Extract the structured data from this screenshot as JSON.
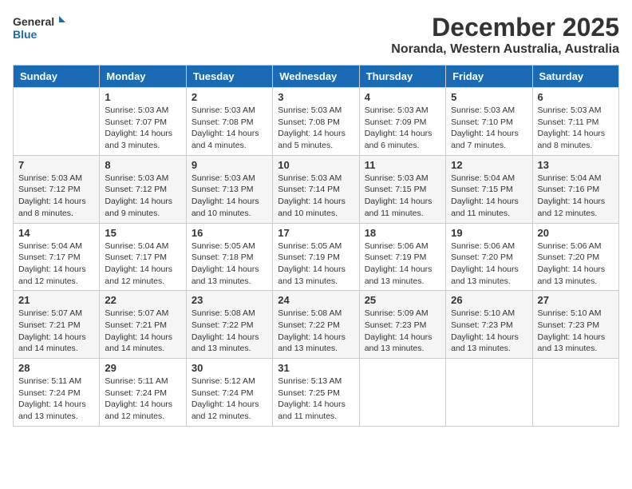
{
  "header": {
    "logo_line1": "General",
    "logo_line2": "Blue",
    "month": "December 2025",
    "location": "Noranda, Western Australia, Australia"
  },
  "days_of_week": [
    "Sunday",
    "Monday",
    "Tuesday",
    "Wednesday",
    "Thursday",
    "Friday",
    "Saturday"
  ],
  "weeks": [
    [
      {
        "day": "",
        "info": ""
      },
      {
        "day": "1",
        "info": "Sunrise: 5:03 AM\nSunset: 7:07 PM\nDaylight: 14 hours\nand 3 minutes."
      },
      {
        "day": "2",
        "info": "Sunrise: 5:03 AM\nSunset: 7:08 PM\nDaylight: 14 hours\nand 4 minutes."
      },
      {
        "day": "3",
        "info": "Sunrise: 5:03 AM\nSunset: 7:08 PM\nDaylight: 14 hours\nand 5 minutes."
      },
      {
        "day": "4",
        "info": "Sunrise: 5:03 AM\nSunset: 7:09 PM\nDaylight: 14 hours\nand 6 minutes."
      },
      {
        "day": "5",
        "info": "Sunrise: 5:03 AM\nSunset: 7:10 PM\nDaylight: 14 hours\nand 7 minutes."
      },
      {
        "day": "6",
        "info": "Sunrise: 5:03 AM\nSunset: 7:11 PM\nDaylight: 14 hours\nand 8 minutes."
      }
    ],
    [
      {
        "day": "7",
        "info": "Sunrise: 5:03 AM\nSunset: 7:12 PM\nDaylight: 14 hours\nand 8 minutes."
      },
      {
        "day": "8",
        "info": "Sunrise: 5:03 AM\nSunset: 7:12 PM\nDaylight: 14 hours\nand 9 minutes."
      },
      {
        "day": "9",
        "info": "Sunrise: 5:03 AM\nSunset: 7:13 PM\nDaylight: 14 hours\nand 10 minutes."
      },
      {
        "day": "10",
        "info": "Sunrise: 5:03 AM\nSunset: 7:14 PM\nDaylight: 14 hours\nand 10 minutes."
      },
      {
        "day": "11",
        "info": "Sunrise: 5:03 AM\nSunset: 7:15 PM\nDaylight: 14 hours\nand 11 minutes."
      },
      {
        "day": "12",
        "info": "Sunrise: 5:04 AM\nSunset: 7:15 PM\nDaylight: 14 hours\nand 11 minutes."
      },
      {
        "day": "13",
        "info": "Sunrise: 5:04 AM\nSunset: 7:16 PM\nDaylight: 14 hours\nand 12 minutes."
      }
    ],
    [
      {
        "day": "14",
        "info": "Sunrise: 5:04 AM\nSunset: 7:17 PM\nDaylight: 14 hours\nand 12 minutes."
      },
      {
        "day": "15",
        "info": "Sunrise: 5:04 AM\nSunset: 7:17 PM\nDaylight: 14 hours\nand 12 minutes."
      },
      {
        "day": "16",
        "info": "Sunrise: 5:05 AM\nSunset: 7:18 PM\nDaylight: 14 hours\nand 13 minutes."
      },
      {
        "day": "17",
        "info": "Sunrise: 5:05 AM\nSunset: 7:19 PM\nDaylight: 14 hours\nand 13 minutes."
      },
      {
        "day": "18",
        "info": "Sunrise: 5:06 AM\nSunset: 7:19 PM\nDaylight: 14 hours\nand 13 minutes."
      },
      {
        "day": "19",
        "info": "Sunrise: 5:06 AM\nSunset: 7:20 PM\nDaylight: 14 hours\nand 13 minutes."
      },
      {
        "day": "20",
        "info": "Sunrise: 5:06 AM\nSunset: 7:20 PM\nDaylight: 14 hours\nand 13 minutes."
      }
    ],
    [
      {
        "day": "21",
        "info": "Sunrise: 5:07 AM\nSunset: 7:21 PM\nDaylight: 14 hours\nand 14 minutes."
      },
      {
        "day": "22",
        "info": "Sunrise: 5:07 AM\nSunset: 7:21 PM\nDaylight: 14 hours\nand 14 minutes."
      },
      {
        "day": "23",
        "info": "Sunrise: 5:08 AM\nSunset: 7:22 PM\nDaylight: 14 hours\nand 13 minutes."
      },
      {
        "day": "24",
        "info": "Sunrise: 5:08 AM\nSunset: 7:22 PM\nDaylight: 14 hours\nand 13 minutes."
      },
      {
        "day": "25",
        "info": "Sunrise: 5:09 AM\nSunset: 7:23 PM\nDaylight: 14 hours\nand 13 minutes."
      },
      {
        "day": "26",
        "info": "Sunrise: 5:10 AM\nSunset: 7:23 PM\nDaylight: 14 hours\nand 13 minutes."
      },
      {
        "day": "27",
        "info": "Sunrise: 5:10 AM\nSunset: 7:23 PM\nDaylight: 14 hours\nand 13 minutes."
      }
    ],
    [
      {
        "day": "28",
        "info": "Sunrise: 5:11 AM\nSunset: 7:24 PM\nDaylight: 14 hours\nand 13 minutes."
      },
      {
        "day": "29",
        "info": "Sunrise: 5:11 AM\nSunset: 7:24 PM\nDaylight: 14 hours\nand 12 minutes."
      },
      {
        "day": "30",
        "info": "Sunrise: 5:12 AM\nSunset: 7:24 PM\nDaylight: 14 hours\nand 12 minutes."
      },
      {
        "day": "31",
        "info": "Sunrise: 5:13 AM\nSunset: 7:25 PM\nDaylight: 14 hours\nand 11 minutes."
      },
      {
        "day": "",
        "info": ""
      },
      {
        "day": "",
        "info": ""
      },
      {
        "day": "",
        "info": ""
      }
    ]
  ]
}
